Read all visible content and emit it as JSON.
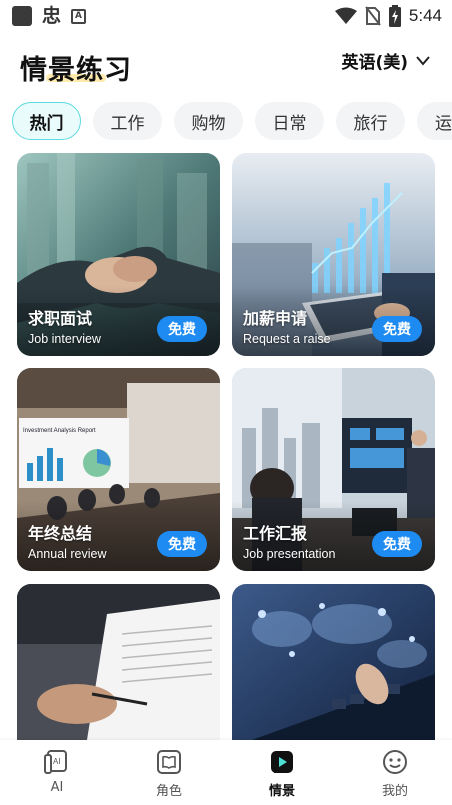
{
  "status_bar": {
    "app_glyph": "忠",
    "small_icon_letter": "A",
    "time": "5:44"
  },
  "header": {
    "title": "情景练习",
    "language": "英语(美)"
  },
  "tabs": [
    {
      "label": "热门",
      "active": true
    },
    {
      "label": "工作",
      "active": false
    },
    {
      "label": "购物",
      "active": false
    },
    {
      "label": "日常",
      "active": false
    },
    {
      "label": "旅行",
      "active": false
    },
    {
      "label": "运",
      "active": false
    }
  ],
  "cards": [
    {
      "title": "求职面试",
      "subtitle": "Job interview",
      "badge": "免费",
      "image": "handshake"
    },
    {
      "title": "加薪申请",
      "subtitle": "Request a raise",
      "badge": "免费",
      "image": "tablet-growth-chart"
    },
    {
      "title": "年终总结",
      "subtitle": "Annual review",
      "badge": "免费",
      "image": "meeting-room-presentation",
      "screen_text": "Investment Analysis Report"
    },
    {
      "title": "工作汇报",
      "subtitle": "Job presentation",
      "badge": "免费",
      "image": "office-presentation-screen"
    },
    {
      "title": "",
      "subtitle": "",
      "badge": "",
      "image": "document-signing"
    },
    {
      "title": "",
      "subtitle": "",
      "badge": "",
      "image": "keyboard-world-map"
    }
  ],
  "bottom_nav": [
    {
      "label": "AI",
      "icon": "ai-icon",
      "active": false
    },
    {
      "label": "角色",
      "icon": "book-icon",
      "active": false
    },
    {
      "label": "情景",
      "icon": "scene-play-icon",
      "active": true
    },
    {
      "label": "我的",
      "icon": "profile-icon",
      "active": false
    }
  ],
  "colors": {
    "accent_blue": "#1d8bf1",
    "tab_active_border": "#5dd9e0",
    "tab_active_bg": "#e9fbfb"
  }
}
